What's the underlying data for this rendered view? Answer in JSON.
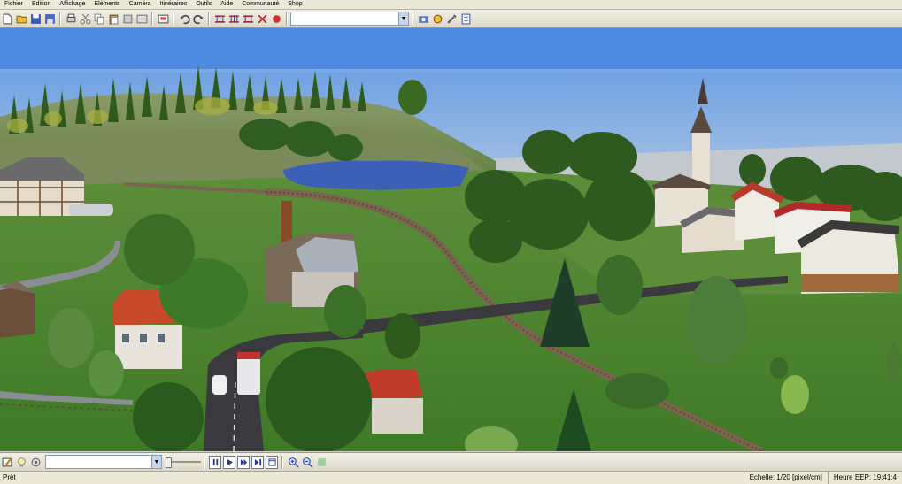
{
  "menu": [
    "Fichier",
    "Edition",
    "Affichage",
    "Eléments",
    "Caméra",
    "Itinéraires",
    "Outils",
    "Aide",
    "Communauté",
    "Shop"
  ],
  "toolbar": {
    "combo_value": "",
    "icons": [
      "new-icon",
      "open-icon",
      "save-icon",
      "save-as-icon",
      "print-icon",
      "cut-icon",
      "copy-icon",
      "paste-icon",
      "delete-icon",
      "import-icon",
      "undo-icon",
      "redo-icon",
      "track-icon",
      "road-icon",
      "tram-icon",
      "water-icon",
      "camera-icon",
      "settings-icon",
      "tools-icon",
      "info-icon"
    ]
  },
  "bottom": {
    "combo_value": "",
    "slider_level": 0.0
  },
  "status": {
    "left": "Prêt",
    "scale": "Echelle: 1/20 [pixel/cm]",
    "time": "Heure EEP: 19:41:4"
  },
  "colors": {
    "sky_top": "#6aa0e0",
    "grass": "#4f8a2e",
    "water": "#3c60b8",
    "road": "#3a3a3e"
  }
}
